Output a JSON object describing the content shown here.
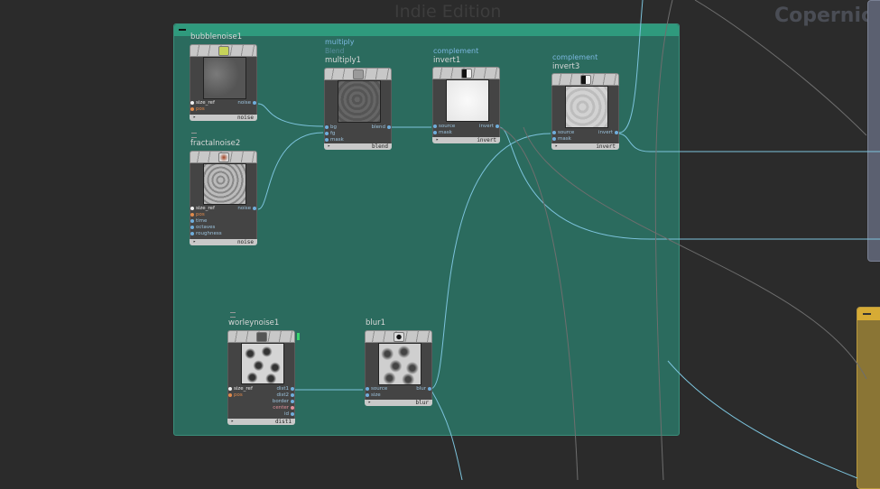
{
  "watermark": "Indie Edition",
  "copernicus_title": "Copernicu",
  "nodes": {
    "bubblenoise1": {
      "name": "bubblenoise1",
      "footer": "noise",
      "inputs": [
        "size_ref",
        "pos"
      ],
      "outputs": [
        "noise"
      ]
    },
    "fractalnoise2": {
      "name": "fractalnoise2",
      "footer": "noise",
      "inputs": [
        "size_ref",
        "pos",
        "time",
        "octaves",
        "roughness"
      ],
      "outputs": [
        "noise"
      ]
    },
    "multiply1": {
      "type": "multiply",
      "subtype": "Blend",
      "name": "multiply1",
      "footer": "blend",
      "inputs": [
        "bg",
        "fg",
        "mask"
      ],
      "outputs": [
        "blend"
      ]
    },
    "invert1": {
      "type": "complement",
      "name": "invert1",
      "footer": "invert",
      "inputs": [
        "source",
        "mask"
      ],
      "outputs": [
        "invert"
      ]
    },
    "invert3": {
      "type": "complement",
      "name": "invert3",
      "footer": "invert",
      "inputs": [
        "source",
        "mask"
      ],
      "outputs": [
        "invert"
      ]
    },
    "worleynoise1": {
      "name": "worleynoise1",
      "footer": "dist1",
      "inputs": [
        "size_ref",
        "pos"
      ],
      "outputs": [
        "dist1",
        "dist2",
        "border",
        "center",
        "id"
      ]
    },
    "blur1": {
      "name": "blur1",
      "footer": "blur",
      "inputs": [
        "source",
        "size"
      ],
      "outputs": [
        "blur"
      ]
    }
  },
  "colors": {
    "background": "#2b2b2b",
    "network_box": "#2b6b5e",
    "network_bar": "#2f9a7d",
    "wire": "#7cc3dc",
    "copernicus_panel": "#5b6070",
    "yellow_node": "#8a7535"
  },
  "icons": {
    "bubblenoise": "bubble-icon",
    "fractalnoise": "sphere-icon",
    "multiply": "cube-icon",
    "complement": "invert-icon",
    "worleynoise": "worley-icon",
    "blur": "blur-icon"
  }
}
